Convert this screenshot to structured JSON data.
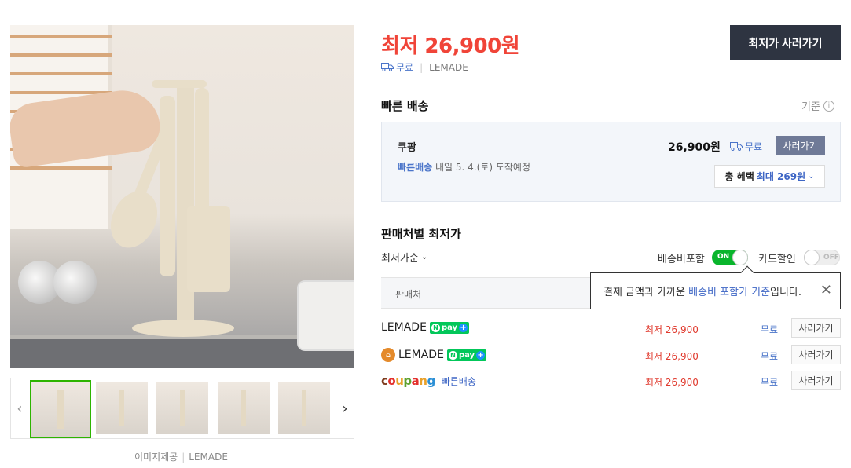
{
  "gallery": {
    "credit_label": "이미지제공",
    "credit_source": "LEMADE",
    "prev_icon": "‹",
    "next_icon": "›"
  },
  "header": {
    "lowest_price": "최저 26,900원",
    "shipping": "무료",
    "seller": "LEMADE",
    "buy_button": "최저가 사러가기"
  },
  "fast_delivery": {
    "title": "빠른 배송",
    "standard_label": "기준",
    "store": "쿠팡",
    "badge": "빠른배송",
    "eta": "내일 5. 4.(토) 도착예정",
    "price": "26,900원",
    "shipping": "무료",
    "buy": "사러가기",
    "benefit_lead": "총 혜택",
    "benefit_value": "최대 269원"
  },
  "sellers": {
    "title": "판매처별 최저가",
    "sort": "최저가순",
    "toggle_shipping": "배송비포함",
    "toggle_shipping_state": "ON",
    "toggle_card": "카드할인",
    "toggle_card_state": "OFF",
    "column_seller": "판매처",
    "tooltip_pre": "결제 금액과 가까운 ",
    "tooltip_highlight": "배송비 포함가 기준",
    "tooltip_post": "입니다.",
    "rows": [
      {
        "name": "LEMADE",
        "price": "최저 26,900",
        "shipping": "무료",
        "buy": "사러가기",
        "npay": "pay"
      },
      {
        "name": "LEMADE",
        "price": "최저 26,900",
        "shipping": "무료",
        "buy": "사러가기",
        "npay": "pay"
      },
      {
        "name": "coupang",
        "rocket": "빠른배송",
        "price": "최저 26,900",
        "shipping": "무료",
        "buy": "사러가기"
      }
    ]
  },
  "colors": {
    "price_red": "#f04438",
    "accent_blue": "#4a74c9",
    "npay_green": "#03c75a",
    "dark_button": "#2e3441"
  }
}
